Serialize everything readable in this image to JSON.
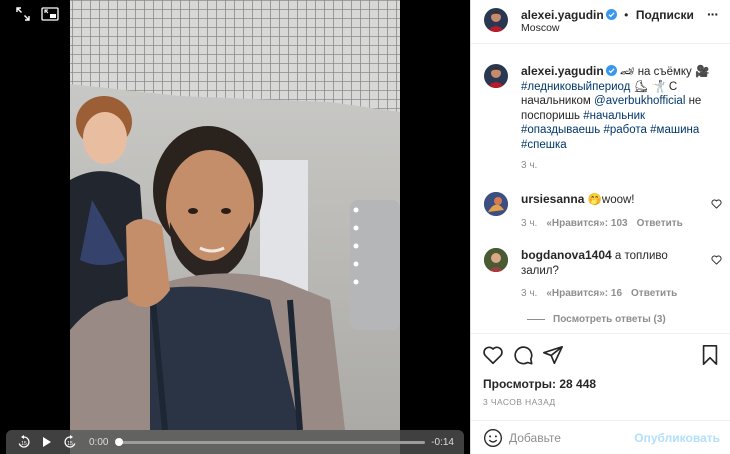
{
  "video": {
    "time_current": "0:00",
    "time_remaining": "-0:14",
    "progress": 0.0,
    "icons": [
      "expand-icon",
      "pip-icon",
      "rewind-15-icon",
      "play-icon",
      "forward-15-icon"
    ]
  },
  "header": {
    "username": "alexei.yagudin",
    "separator": "•",
    "follow_label": "Подписки",
    "location": "Moscow",
    "more_label": "···"
  },
  "caption": {
    "username": "alexei.yagudin",
    "segments": [
      {
        "text": " 🏎 на съёмку 🎥 ",
        "type": "text"
      },
      {
        "text": "#ледниковыйпериод",
        "type": "tag"
      },
      {
        "text": " ⛸ 🤺 С начальником ",
        "type": "text"
      },
      {
        "text": "@averbukhofficial",
        "type": "tag"
      },
      {
        "text": " не поспоришь ",
        "type": "text"
      },
      {
        "text": "#начальник",
        "type": "tag"
      },
      {
        "text": " ",
        "type": "text"
      },
      {
        "text": "#опаздываешь",
        "type": "tag"
      },
      {
        "text": " ",
        "type": "text"
      },
      {
        "text": "#работа",
        "type": "tag"
      },
      {
        "text": " ",
        "type": "text"
      },
      {
        "text": "#машина",
        "type": "tag"
      },
      {
        "text": " ",
        "type": "text"
      },
      {
        "text": "#спешка",
        "type": "tag"
      }
    ],
    "time": "3 ч."
  },
  "comments": [
    {
      "username": "ursiesanna",
      "text": "🤭woow!",
      "time": "3 ч.",
      "likes": "«Нравится»: 103",
      "reply": "Ответить"
    },
    {
      "username": "bogdanova1404",
      "text": "а топливо залил?",
      "time": "3 ч.",
      "likes": "«Нравится»: 16",
      "reply": "Ответить"
    }
  ],
  "view_replies": "Посмотреть ответы (3)",
  "stats": {
    "views": "Просмотры: 28 448",
    "ago": "3 ЧАСОВ НАЗАД"
  },
  "compose": {
    "placeholder": "Добавьте комментарий...",
    "placeholder_visible": "Добавьте",
    "post_label": "Опубликовать"
  },
  "colors": {
    "link": "#00376b",
    "verified": "#3897f0",
    "post_disabled": "#b2dffc",
    "muted": "#8e8e8e"
  }
}
